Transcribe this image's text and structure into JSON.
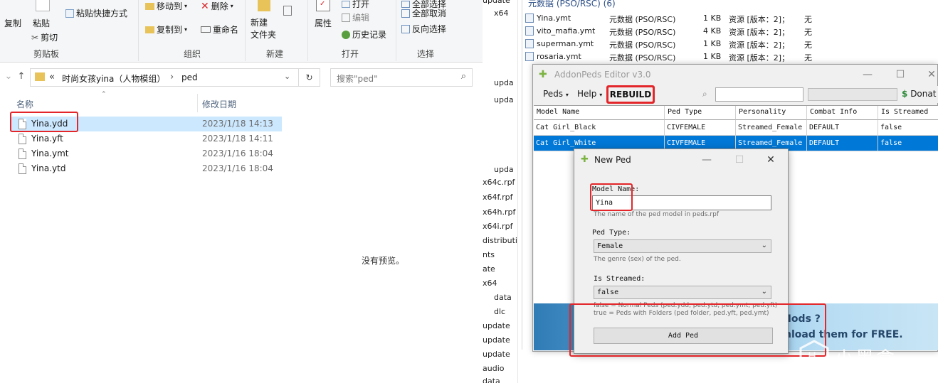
{
  "explorer": {
    "ribbon": {
      "copy": "复制",
      "paste": "粘贴",
      "paste_shortcut": "粘贴快捷方式",
      "cut": "剪切",
      "move_to": "移动到",
      "copy_to": "复制到",
      "delete": "删除",
      "rename": "重命名",
      "new_folder": "新建\n文件夹",
      "properties": "属性",
      "open": "打开",
      "edit": "编辑",
      "history": "历史记录",
      "select_all": "全部选择",
      "select_none": "全部取消",
      "invert_selection": "反向选择",
      "groups": {
        "clipboard": "剪贴板",
        "organize": "组织",
        "new": "新建",
        "open": "打开",
        "select": "选择"
      }
    },
    "address": {
      "path_prefix": "«",
      "path_parent": "时尚女孩yina（人物模组）",
      "path_sep": "›",
      "path_current": "ped",
      "search_placeholder": "搜索\"ped\""
    },
    "columns": {
      "name": "名称",
      "date": "修改日期"
    },
    "files": [
      {
        "name": "Yina.ydd",
        "date": "2023/1/18 14:13"
      },
      {
        "name": "Yina.yft",
        "date": "2023/1/18 14:11"
      },
      {
        "name": "Yina.ymt",
        "date": "2023/1/16 18:04"
      },
      {
        "name": "Yina.ytd",
        "date": "2023/1/16 18:04"
      }
    ],
    "no_preview": "没有预览。"
  },
  "background": {
    "strip": [
      "update",
      "x64",
      "",
      "",
      "",
      "upda",
      "upda",
      "",
      "",
      "",
      "upda",
      "x64c.rpf",
      "x64f.rpf",
      "x64h.rpf",
      "x64i.rpf",
      "distribution",
      "nts",
      "ate",
      "x64",
      "data",
      "dlc",
      "update",
      "update",
      "update",
      "audio",
      "data"
    ],
    "header": "元数据 (PSO/RSC) (6)",
    "rows": [
      {
        "name": "Yina.ymt",
        "type": "元数据 (PSO/RSC)",
        "size": "1 KB",
        "info": "资源 [版本：2]；",
        "extra": "无"
      },
      {
        "name": "vito_mafia.ymt",
        "type": "元数据 (PSO/RSC)",
        "size": "4 KB",
        "info": "资源 [版本：2]；",
        "extra": "无"
      },
      {
        "name": "superman.ymt",
        "type": "元数据 (PSO/RSC)",
        "size": "1 KB",
        "info": "资源 [版本：2]；",
        "extra": "无"
      },
      {
        "name": "rosaria.ymt",
        "type": "元数据 (PSO/RSC)",
        "size": "1 KB",
        "info": "资源 [版本：2]；",
        "extra": "无"
      }
    ]
  },
  "editor": {
    "title": "AddonPeds Editor v3.0",
    "menu": {
      "peds": "Peds",
      "help": "Help",
      "rebuild": "REBUILD",
      "donate": "Donat"
    },
    "columns": [
      "Model Name",
      "Ped Type",
      "Personality",
      "Combat Info",
      "Is Streamed"
    ],
    "rows": [
      [
        "Cat Girl_Black",
        "CIVFEMALE",
        "Streamed_Female",
        "DEFAULT",
        "false"
      ],
      [
        "Cat Girl_White",
        "CIVFEMALE",
        "Streamed_Female",
        "DEFAULT",
        "false"
      ]
    ],
    "banner": {
      "line1": "Mods ?",
      "line2": "nload them for FREE."
    }
  },
  "new_ped": {
    "title": "New Ped",
    "model_name_label": "Model Name:",
    "model_name_value": "Yina",
    "model_name_hint": "The name of the ped model in peds.rpf",
    "ped_type_label": "Ped Type:",
    "ped_type_value": "Female",
    "ped_type_hint": "The genre (sex) of the ped.",
    "streamed_label": "Is Streamed:",
    "streamed_value": "false",
    "streamed_hint1": "false = Normal Peds (ped.ydd, ped.ytd, ped.ymt, ped.yft)",
    "streamed_hint2": "true = Peds with Folders (ped folder, ped.yft, ped.ymt)",
    "add_button": "Add Ped"
  },
  "watermark": "小黑盒",
  "colors": {
    "highlight_red": "#e3262a",
    "selection_blue": "#0078d7",
    "explorer_selection": "#cce8ff"
  }
}
